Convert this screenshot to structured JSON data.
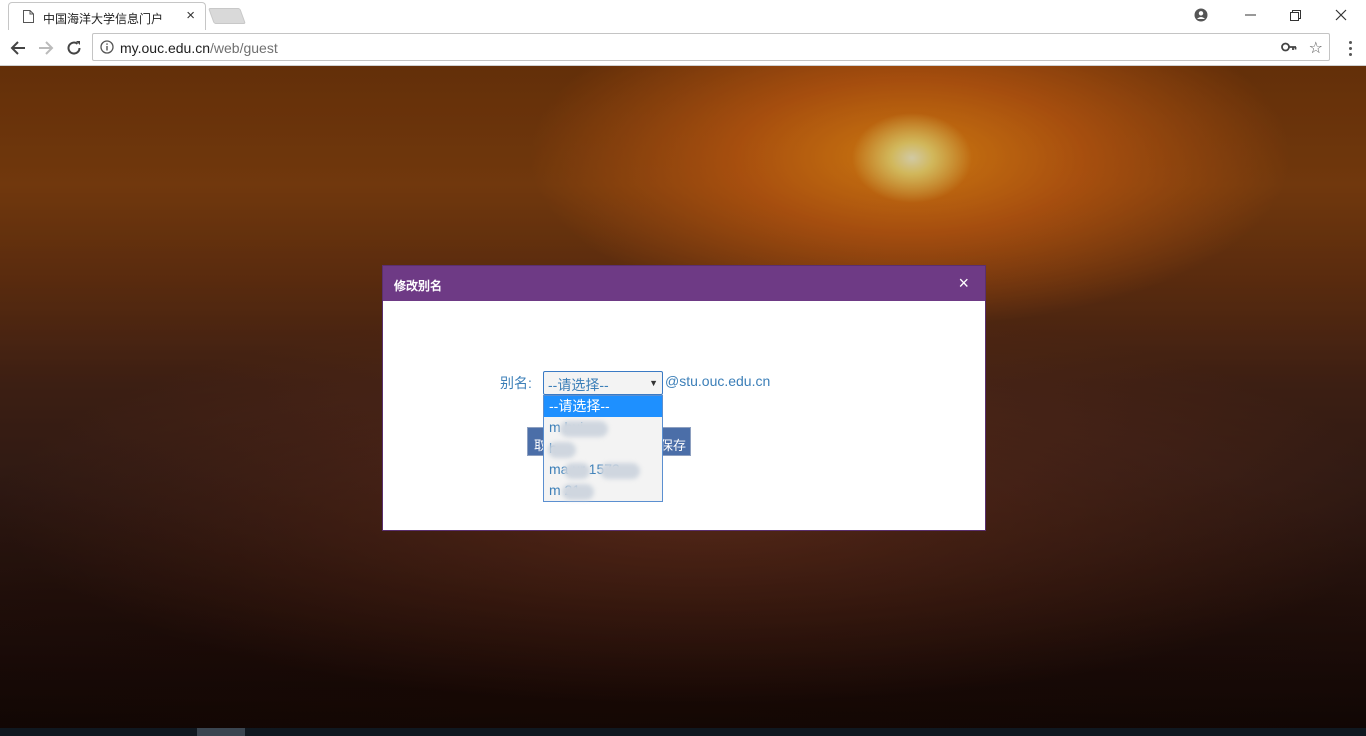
{
  "browser": {
    "tab_title": "中国海洋大学信息门户",
    "url_host": "my.ouc.edu.cn",
    "url_path": "/web/guest"
  },
  "dialog": {
    "title": "修改别名",
    "close_glyph": "×",
    "alias_label": "别名:",
    "selected_value": "--请选择--",
    "domain_suffix": "@stu.ouc.edu.cn",
    "cancel_label": "取",
    "save_label": "保存",
    "options": [
      "--请选择--",
      "m        hui",
      "  h",
      "ma    ur      1573",
      "m      21"
    ]
  },
  "colors": {
    "header": "#6e3a85",
    "accent_text": "#3c7fb8",
    "button": "#4b6ea8",
    "selected_option": "#1e90ff"
  },
  "icons": [
    "page-icon",
    "tab-close-icon",
    "profile-icon",
    "minimize-icon",
    "restore-icon",
    "close-window-icon",
    "back-arrow-icon",
    "forward-arrow-icon",
    "reload-icon",
    "info-icon",
    "key-icon",
    "star-icon",
    "menu-icon",
    "dialog-close-icon",
    "dropdown-arrow-icon"
  ]
}
